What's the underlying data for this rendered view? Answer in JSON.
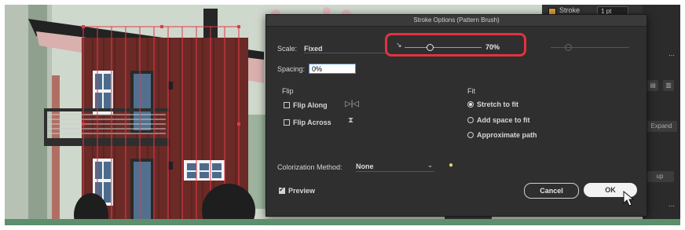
{
  "app": {
    "top_bar": {
      "stroke_label": "Stroke",
      "stroke_weight": "1 pt"
    },
    "side_panel": {
      "expand_label": "Expand",
      "partial_label": "up"
    },
    "colors": {
      "highlight": "#e2323f",
      "dialog_bg": "#2f2f2f",
      "house_siding": "#6b2a26",
      "selection": "#e23a4a"
    }
  },
  "dialog": {
    "title": "Stroke Options (Pattern Brush)",
    "scale": {
      "label": "Scale:",
      "mode": "Fixed",
      "value": "70%",
      "slider_fraction": 0.33
    },
    "spacing": {
      "label": "Spacing:",
      "value": "0%"
    },
    "flip": {
      "title": "Flip",
      "along_label": "Flip Along",
      "along_checked": false,
      "across_label": "Flip Across",
      "across_checked": false
    },
    "fit": {
      "title": "Fit",
      "options": [
        {
          "label": "Stretch to fit",
          "checked": true
        },
        {
          "label": "Add space to fit",
          "checked": false
        },
        {
          "label": "Approximate path",
          "checked": false
        }
      ]
    },
    "colorization": {
      "label": "Colorization Method:",
      "value": "None"
    },
    "preview": {
      "label": "Preview",
      "checked": true
    },
    "buttons": {
      "cancel": "Cancel",
      "ok": "OK"
    }
  }
}
